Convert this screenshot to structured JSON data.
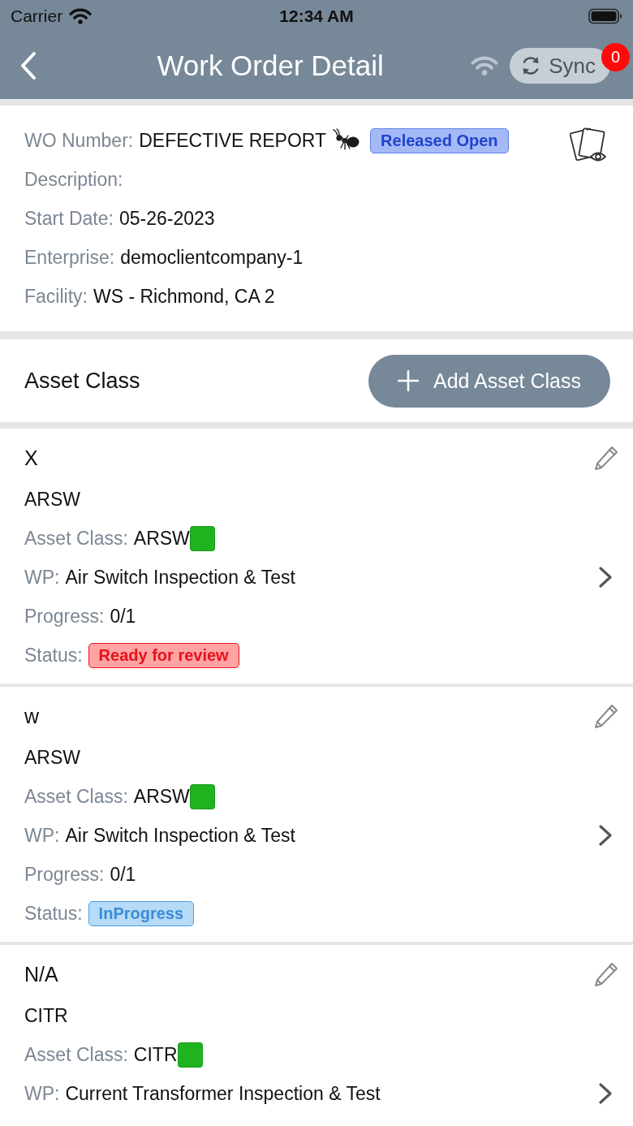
{
  "status_bar": {
    "carrier": "Carrier",
    "time": "12:34 AM"
  },
  "nav": {
    "title": "Work Order Detail",
    "sync_label": "Sync",
    "sync_count": "0"
  },
  "work_order": {
    "number": {
      "label": "WO Number:",
      "value": "DEFECTIVE REPORT",
      "badge": {
        "text": "Released Open",
        "kind": "released"
      }
    },
    "fields": [
      {
        "label": "Description:"
      },
      {
        "label": "Start Date:",
        "value": "05-26-2023"
      },
      {
        "label": "Enterprise:",
        "value": "democlientcompany-1"
      },
      {
        "label": "Facility:",
        "value": "WS - Richmond, CA 2"
      }
    ]
  },
  "asset_section": {
    "title": "Asset Class",
    "add_button": "Add Asset Class"
  },
  "assets": [
    {
      "name": "X",
      "code": "ARSW",
      "fields": [
        {
          "kind": "class",
          "label": "Asset Class:",
          "value": "ARSW"
        },
        {
          "kind": "link",
          "label": "WP:",
          "value": "Air Switch Inspection & Test"
        },
        {
          "kind": "text",
          "label": "Progress:",
          "value": "0/1"
        },
        {
          "kind": "status",
          "label": "Status:",
          "badge": {
            "text": "Ready for review",
            "kind": "review"
          }
        }
      ]
    },
    {
      "name": "w",
      "code": "ARSW",
      "fields": [
        {
          "kind": "class",
          "label": "Asset Class:",
          "value": "ARSW"
        },
        {
          "kind": "link",
          "label": "WP:",
          "value": "Air Switch Inspection & Test"
        },
        {
          "kind": "text",
          "label": "Progress:",
          "value": "0/1"
        },
        {
          "kind": "status",
          "label": "Status:",
          "badge": {
            "text": "InProgress",
            "kind": "inprogress"
          }
        }
      ]
    },
    {
      "name": "N/A",
      "code": "CITR",
      "fields": [
        {
          "kind": "class",
          "label": "Asset Class:",
          "value": "CITR"
        },
        {
          "kind": "link",
          "label": "WP:",
          "value": "Current Transformer Inspection & Test"
        }
      ]
    }
  ]
}
